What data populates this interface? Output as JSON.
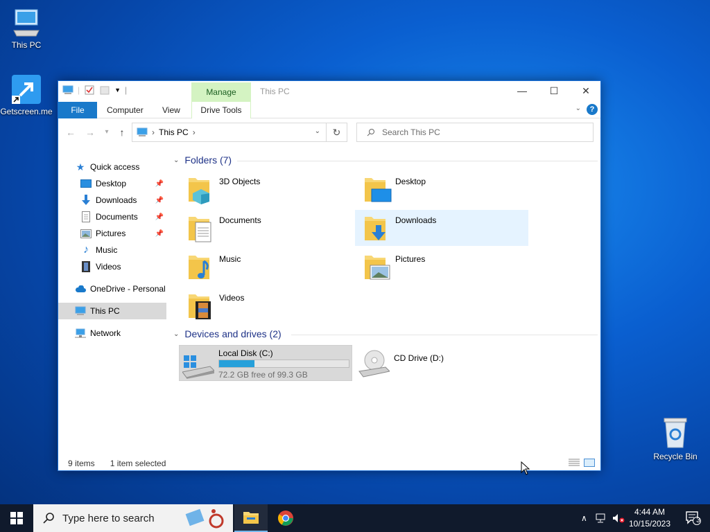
{
  "desktop": {
    "icons": [
      {
        "label": "This PC"
      },
      {
        "label": "Getscreen.me"
      },
      {
        "label": "Recycle Bin"
      }
    ]
  },
  "window": {
    "title": "This PC",
    "manage_tab": "Manage",
    "ribbon_tabs": [
      "File",
      "Computer",
      "View",
      "Drive Tools"
    ],
    "controls": {
      "minimize": "—",
      "maximize": "☐",
      "close": "✕"
    },
    "help": "?"
  },
  "navbar": {
    "back": "←",
    "forward": "→",
    "recent": "▾",
    "up": "↑",
    "address": "This PC",
    "address_sep": "›",
    "search_placeholder": "Search This PC"
  },
  "navpane": {
    "quick_access": "Quick access",
    "items": [
      {
        "label": "Desktop",
        "pinned": true
      },
      {
        "label": "Downloads",
        "pinned": true
      },
      {
        "label": "Documents",
        "pinned": true
      },
      {
        "label": "Pictures",
        "pinned": true
      },
      {
        "label": "Music",
        "pinned": false
      },
      {
        "label": "Videos",
        "pinned": false
      }
    ],
    "onedrive": "OneDrive - Personal",
    "this_pc": "This PC",
    "network": "Network"
  },
  "content": {
    "folders_header": "Folders (7)",
    "folders": [
      {
        "name": "3D Objects"
      },
      {
        "name": "Desktop"
      },
      {
        "name": "Documents"
      },
      {
        "name": "Downloads"
      },
      {
        "name": "Music"
      },
      {
        "name": "Pictures"
      },
      {
        "name": "Videos"
      }
    ],
    "drives_header": "Devices and drives (2)",
    "drives": [
      {
        "name": "Local Disk (C:)",
        "free": "72.2 GB free of 99.3 GB",
        "used_fraction": 0.273
      },
      {
        "name": "CD Drive (D:)"
      }
    ]
  },
  "status": {
    "items": "9 items",
    "selected": "1 item selected"
  },
  "taskbar": {
    "search_placeholder": "Type here to search",
    "time": "4:44 AM",
    "date": "10/15/2023",
    "notification_count": "3"
  },
  "colors": {
    "accent": "#1979ca",
    "folder": "#f8d775",
    "selection": "#e5f3ff",
    "drive_fill": "#26a0da",
    "manage_bg": "#d4f3c2"
  }
}
